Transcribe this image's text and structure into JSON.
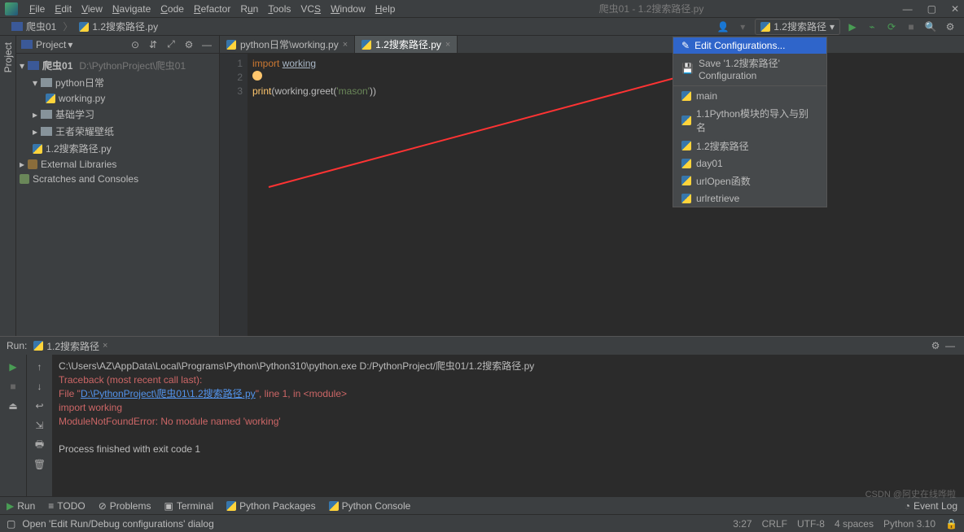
{
  "window": {
    "title": "爬虫01 - 1.2搜索路径.py"
  },
  "menus": [
    "File",
    "Edit",
    "View",
    "Navigate",
    "Code",
    "Refactor",
    "Run",
    "Tools",
    "VCS",
    "Window",
    "Help"
  ],
  "breadcrumbs": {
    "items": [
      "爬虫01",
      "1.2搜索路径.py"
    ]
  },
  "toolbar": {
    "run_config_label": "1.2搜索路径"
  },
  "run_config_dropdown": {
    "edit_configurations": "Edit Configurations...",
    "save_config": "Save '1.2搜索路径' Configuration",
    "items": [
      "main",
      "1.1Python模块的导入与别名",
      "1.2搜索路径",
      "day01",
      "urlOpen函数",
      "urlretrieve"
    ]
  },
  "sidebar": {
    "title": "Project",
    "root": {
      "name": "爬虫01",
      "path": "D:\\PythonProject\\爬虫01"
    },
    "tree": [
      {
        "label": "python日常",
        "type": "folder"
      },
      {
        "label": "working.py",
        "type": "pyfile"
      },
      {
        "label": "基础学习",
        "type": "folder"
      },
      {
        "label": "王者荣耀壁纸",
        "type": "folder"
      },
      {
        "label": "1.2搜索路径.py",
        "type": "pyfile"
      }
    ],
    "external_libraries": "External Libraries",
    "scratches": "Scratches and Consoles"
  },
  "editor_tabs": [
    {
      "label": "python日常\\working.py",
      "active": false
    },
    {
      "label": "1.2搜索路径.py",
      "active": true
    }
  ],
  "code": {
    "lines": [
      "1",
      "2",
      "3"
    ],
    "l1_kw": "import",
    "l1_id": "working",
    "l3_fn": "print",
    "l3_mid": "(working.greet(",
    "l3_str": "'mason'",
    "l3_end": "))"
  },
  "run": {
    "label": "Run:",
    "config": "1.2搜索路径",
    "output": {
      "cmd": "C:\\Users\\AZ\\AppData\\Local\\Programs\\Python\\Python310\\python.exe D:/PythonProject/爬虫01/1.2搜索路径.py",
      "trace1": "Traceback (most recent call last):",
      "trace2a": "  File \"",
      "trace2_link": "D:\\PythonProject\\爬虫01\\1.2搜索路径.py",
      "trace2b": "\", line 1, in <module>",
      "trace3": "    import working",
      "trace4": "ModuleNotFoundError: No module named 'working'",
      "exit": "Process finished with exit code 1"
    }
  },
  "bottom_tabs": [
    "Run",
    "TODO",
    "Problems",
    "Terminal",
    "Python Packages",
    "Python Console"
  ],
  "bottom_right": "Event Log",
  "status": {
    "msg": "Open 'Edit Run/Debug configurations' dialog",
    "pos": "3:27",
    "eol": "CRLF",
    "enc": "UTF-8",
    "indent": "4 spaces",
    "lang": "Python 3.10",
    "branch": ""
  },
  "watermark": "CSDN @阿史在线哗啦"
}
